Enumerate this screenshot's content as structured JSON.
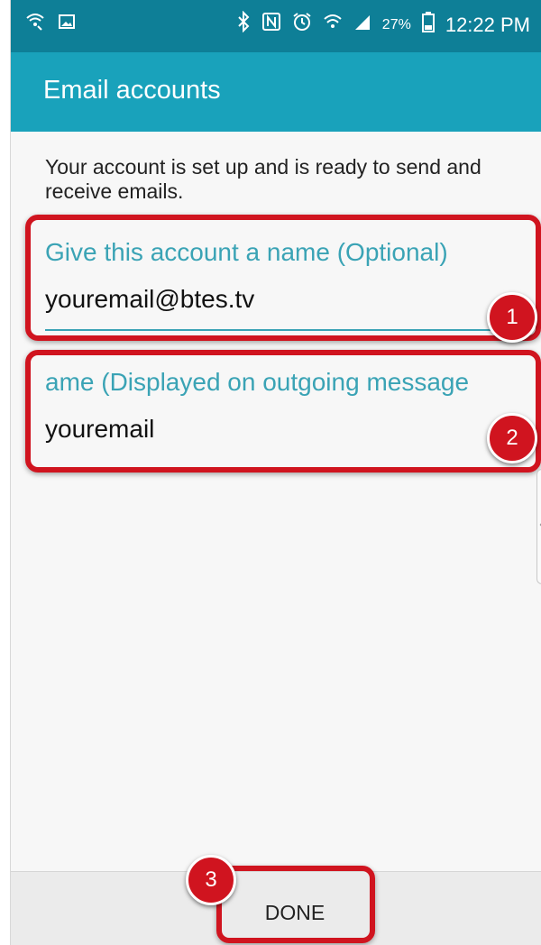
{
  "status_bar": {
    "icons_left": [
      "wifi-call-icon",
      "image-icon"
    ],
    "icons_right": [
      "bluetooth-icon",
      "nfc-icon",
      "alarm-icon",
      "wifi-icon",
      "signal-icon",
      "battery-icon"
    ],
    "battery": "27%",
    "time": "12:22 PM"
  },
  "app_bar": {
    "title": "Email accounts"
  },
  "intro": {
    "text": "Your account is set up and is ready to send and receive emails."
  },
  "fields": {
    "account_name": {
      "label": "Give this account a name (Optional)",
      "value": "youremail@btes.tv"
    },
    "display_name": {
      "label": "ame (Displayed on outgoing message",
      "value": "youremail"
    }
  },
  "callouts": {
    "one": "1",
    "two": "2",
    "three": "3"
  },
  "footer": {
    "done_label": "DONE"
  },
  "colors": {
    "status_bar": "#0e7f97",
    "app_bar": "#19a2bb",
    "accent": "#3aa3b5",
    "callout": "#d0141f"
  }
}
